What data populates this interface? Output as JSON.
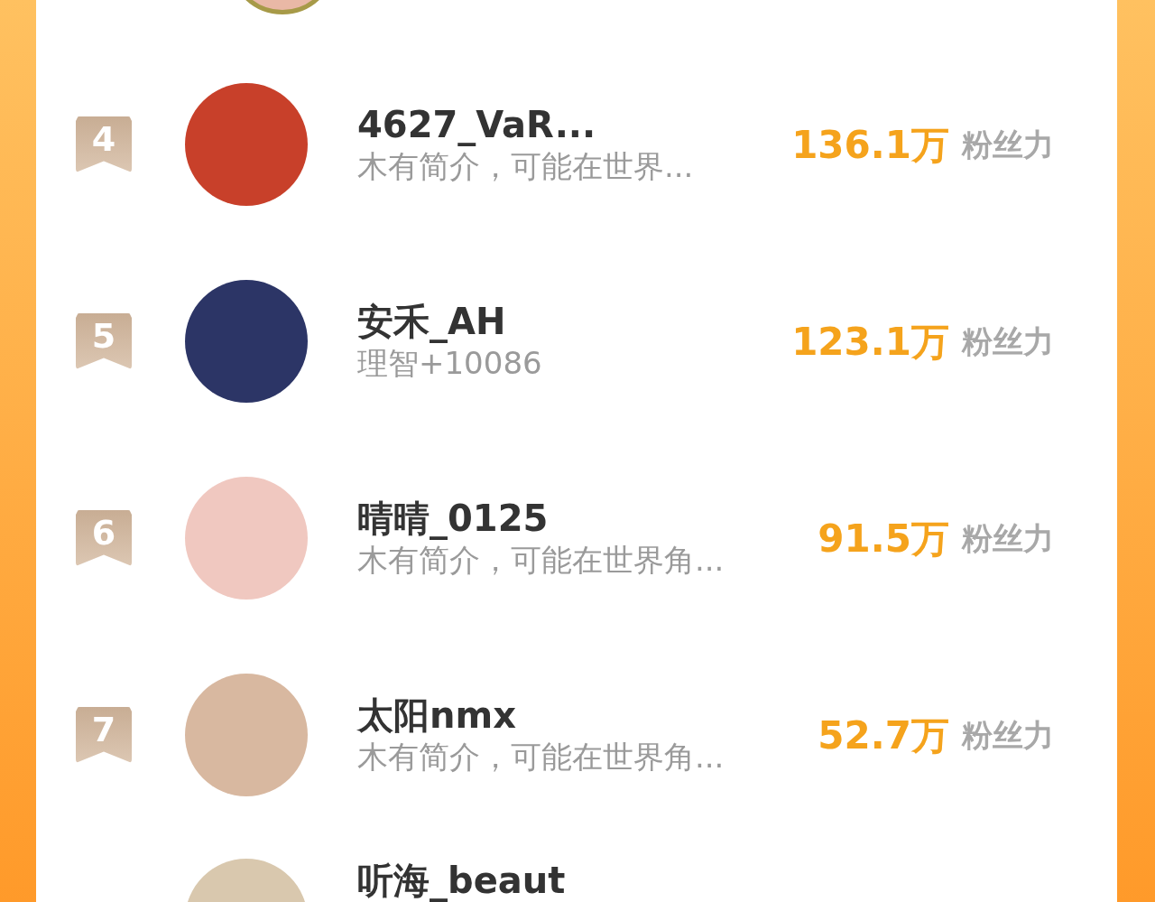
{
  "ranking": [
    {
      "rank": "4",
      "name": "4627_VaR...",
      "bio": "木有简介，可能在世界...",
      "fans": "136.1万",
      "fans_label": "粉丝力"
    },
    {
      "rank": "5",
      "name": "安禾_AH",
      "bio": "理智+10086",
      "fans": "123.1万",
      "fans_label": "粉丝力"
    },
    {
      "rank": "6",
      "name": "晴晴_0125",
      "bio": "木有简介，可能在世界角...",
      "fans": "91.5万",
      "fans_label": "粉丝力"
    },
    {
      "rank": "7",
      "name": "太阳nmx",
      "bio": "木有简介，可能在世界角...",
      "fans": "52.7万",
      "fans_label": "粉丝力"
    }
  ],
  "cut_off_row": {
    "name": "听海_beaut"
  }
}
